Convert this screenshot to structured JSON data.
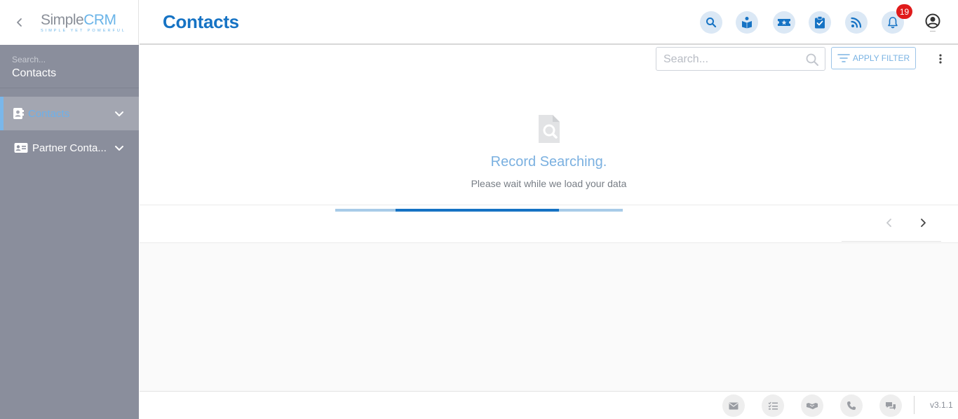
{
  "brand": {
    "name_part1": "Simple",
    "name_part2": "CRM",
    "tagline": "SIMPLE YET POWERFUL"
  },
  "sidebar": {
    "search_placeholder": "Search...",
    "search_value": "Contacts",
    "items": [
      {
        "label": "Contacts",
        "icon": "contact-book-icon",
        "active": true
      },
      {
        "label": "Partner Conta...",
        "icon": "id-card-icon",
        "active": false
      }
    ]
  },
  "header": {
    "title": "Contacts",
    "icons": [
      "search-icon",
      "book-reader-icon",
      "ticket-icon",
      "clipboard-check-icon",
      "rss-icon",
      "bell-icon",
      "user-circle-icon"
    ],
    "notification_count": "19"
  },
  "toolbar": {
    "search_placeholder": "Search...",
    "filter_label": "APPLY FILTER"
  },
  "empty_state": {
    "title": "Record Searching.",
    "subtitle": "Please wait while we load your data"
  },
  "footer": {
    "icons": [
      "envelope-icon",
      "task-list-icon",
      "handshake-icon",
      "phone-icon",
      "comments-icon"
    ],
    "version": "v3.1.1"
  },
  "colors": {
    "primary": "#1673c4",
    "accent_light": "#7ab3e3",
    "sidebar_bg": "#8a8e9c",
    "sidebar_active_bg": "#a3a6b1",
    "badge": "#e01b1b"
  }
}
